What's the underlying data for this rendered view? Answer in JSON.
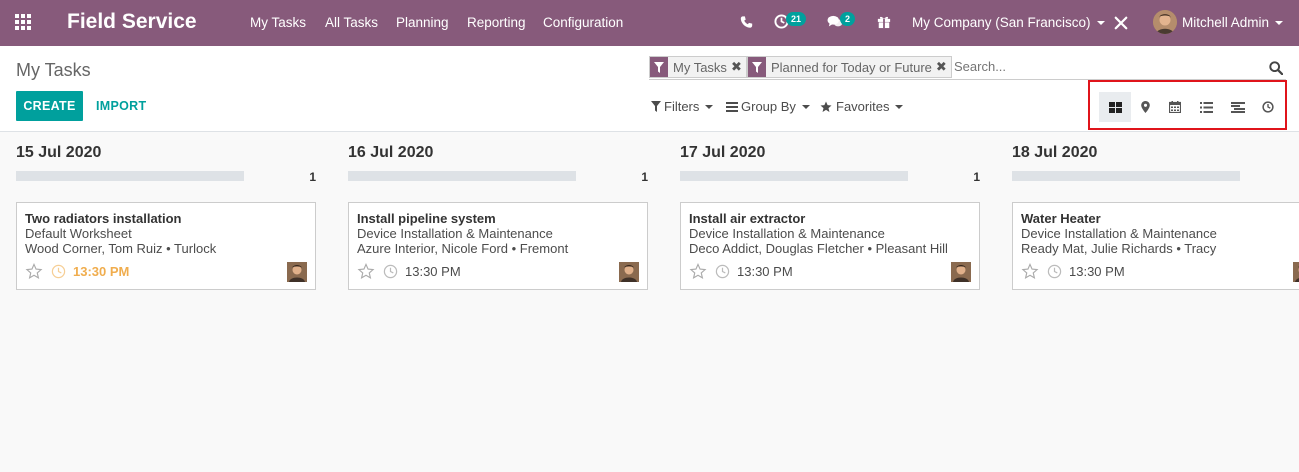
{
  "navbar": {
    "brand": "Field Service",
    "menu": [
      "My Tasks",
      "All Tasks",
      "Planning",
      "Reporting",
      "Configuration"
    ],
    "activity_count": "21",
    "message_count": "2",
    "company": "My Company (San Francisco)",
    "user": "Mitchell Admin"
  },
  "control_panel": {
    "title": "My Tasks",
    "create_label": "CREATE",
    "import_label": "IMPORT",
    "facets": [
      "My Tasks",
      "Planned for Today or Future"
    ],
    "search_placeholder": "Search...",
    "filters_label": "Filters",
    "groupby_label": "Group By",
    "favorites_label": "Favorites",
    "views": [
      "kanban",
      "map",
      "calendar",
      "list",
      "gantt",
      "activity"
    ],
    "active_view": "kanban"
  },
  "columns": [
    {
      "title": "15 Jul 2020",
      "count": "1",
      "card": {
        "name": "Two radiators installation",
        "project": "Default Worksheet",
        "customer": "Wood Corner, Tom Ruiz • Turlock",
        "time": "13:30 PM",
        "time_warning": true
      }
    },
    {
      "title": "16 Jul 2020",
      "count": "1",
      "card": {
        "name": "Install pipeline system",
        "project": "Device Installation & Maintenance",
        "customer": "Azure Interior, Nicole Ford • Fremont",
        "time": "13:30 PM",
        "time_warning": false
      }
    },
    {
      "title": "17 Jul 2020",
      "count": "1",
      "card": {
        "name": "Install air extractor",
        "project": "Device Installation & Maintenance",
        "customer": "Deco Addict, Douglas Fletcher • Pleasant Hill",
        "time": "13:30 PM",
        "time_warning": false
      }
    },
    {
      "title": "18 Jul 2020",
      "count": "",
      "card": {
        "name": "Water Heater",
        "project": "Device Installation & Maintenance",
        "customer": "Ready Mat, Julie Richards • Tracy",
        "time": "13:30 PM",
        "time_warning": false
      }
    }
  ],
  "colors": {
    "brand": "#875a7b",
    "accent": "#00a09d",
    "warning": "#f0ad4e",
    "highlight": "#e0141b"
  }
}
